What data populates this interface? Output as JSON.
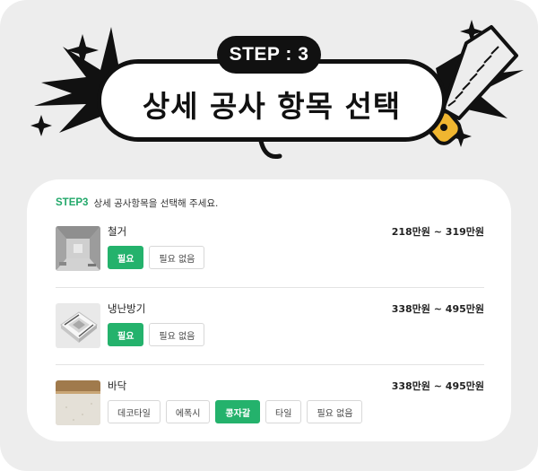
{
  "banner": {
    "step_label": "STEP : 3",
    "title": "상세 공사 항목 선택"
  },
  "card": {
    "step_tag": "STEP3",
    "instruction": "상세 공사항목을 선택해 주세요.",
    "items": [
      {
        "name": "철거",
        "price": "218만원 ~ 319만원",
        "thumb_icon": "demolition-photo",
        "options": [
          {
            "label": "필요",
            "selected": true
          },
          {
            "label": "필요 없음",
            "selected": false
          }
        ]
      },
      {
        "name": "냉난방기",
        "price": "338만원 ~ 495만원",
        "thumb_icon": "ceiling-ac-photo",
        "options": [
          {
            "label": "필요",
            "selected": true
          },
          {
            "label": "필요 없음",
            "selected": false
          }
        ]
      },
      {
        "name": "바닥",
        "price": "338만원 ~ 495만원",
        "thumb_icon": "floor-photo",
        "options": [
          {
            "label": "데코타일",
            "selected": false
          },
          {
            "label": "에폭시",
            "selected": false
          },
          {
            "label": "콩자갈",
            "selected": true
          },
          {
            "label": "타일",
            "selected": false
          },
          {
            "label": "필요 없음",
            "selected": false
          }
        ]
      }
    ]
  },
  "colors": {
    "accent": "#24b26c",
    "background": "#ededed",
    "ink": "#111111"
  }
}
